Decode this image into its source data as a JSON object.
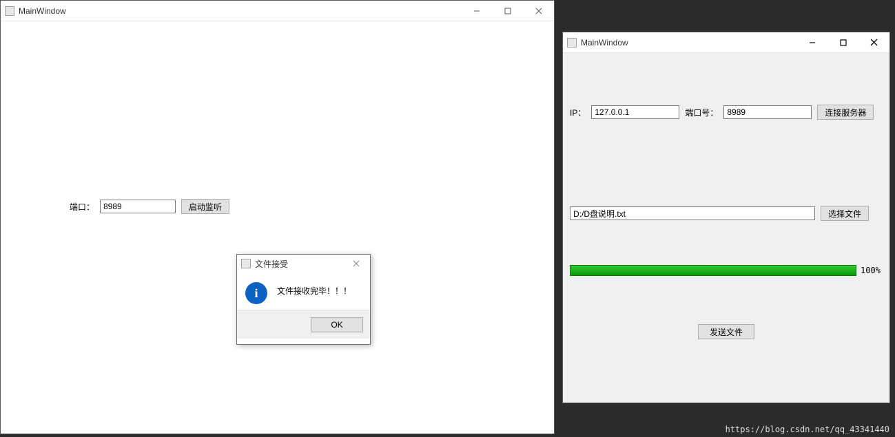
{
  "left_window": {
    "title": "MainWindow",
    "port_label": "端口：",
    "port_value": "8989",
    "start_listen_label": "启动监听"
  },
  "dialog": {
    "title": "文件接受",
    "message": "文件接收完毕！！！",
    "ok_label": "OK"
  },
  "right_window": {
    "title": "MainWindow",
    "ip_label": "IP：",
    "ip_value": "127.0.0.1",
    "port_label": "端口号：",
    "port_value": "8989",
    "connect_label": "连接服务器",
    "file_path": "D:/D盘说明.txt",
    "choose_file_label": "选择文件",
    "progress_percent": "100%",
    "send_file_label": "发送文件"
  },
  "watermark": "https://blog.csdn.net/qq_43341440"
}
